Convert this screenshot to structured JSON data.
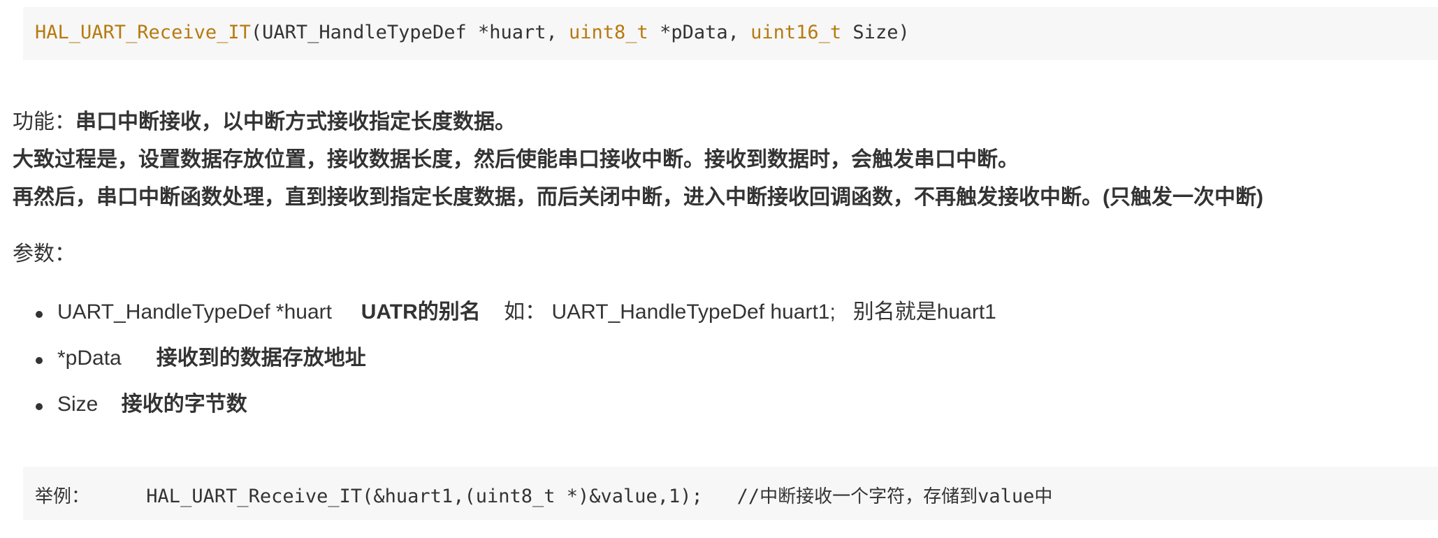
{
  "code_top": {
    "func_name": "HAL_UART_Receive_IT",
    "open": "(UART_HandleTypeDef *huart, ",
    "type1": "uint8_t",
    "mid": " *pData, ",
    "type2": "uint16_t",
    "close": " Size)"
  },
  "description": {
    "label": "功能：",
    "summary": "串口中断接收，以中断方式接收指定长度数据。",
    "line2": "大致过程是，设置数据存放位置，接收数据长度，然后使能串口接收中断。接收到数据时，会触发串口中断。",
    "line3": "再然后，串口中断函数处理，直到接收到指定长度数据，而后关闭中断，进入中断接收回调函数，不再触发接收中断。(只触发一次中断)"
  },
  "params": {
    "label": "参数：",
    "items": [
      {
        "name": "UART_HandleTypeDef *huart",
        "desc": "UATR的别名",
        "note": "如： UART_HandleTypeDef huart1;   别名就是huart1"
      },
      {
        "name": "*pData",
        "desc": "接收到的数据存放地址",
        "note": ""
      },
      {
        "name": "Size",
        "desc": "接收的字节数",
        "note": ""
      }
    ]
  },
  "code_bottom": {
    "label": "举例：",
    "code": "HAL_UART_Receive_IT(&huart1,(uint8_t *)&value,1);",
    "comment_prefix": "//",
    "comment_cn": "中断接收一个字符，存储到",
    "comment_var": "value",
    "comment_end": "中"
  }
}
